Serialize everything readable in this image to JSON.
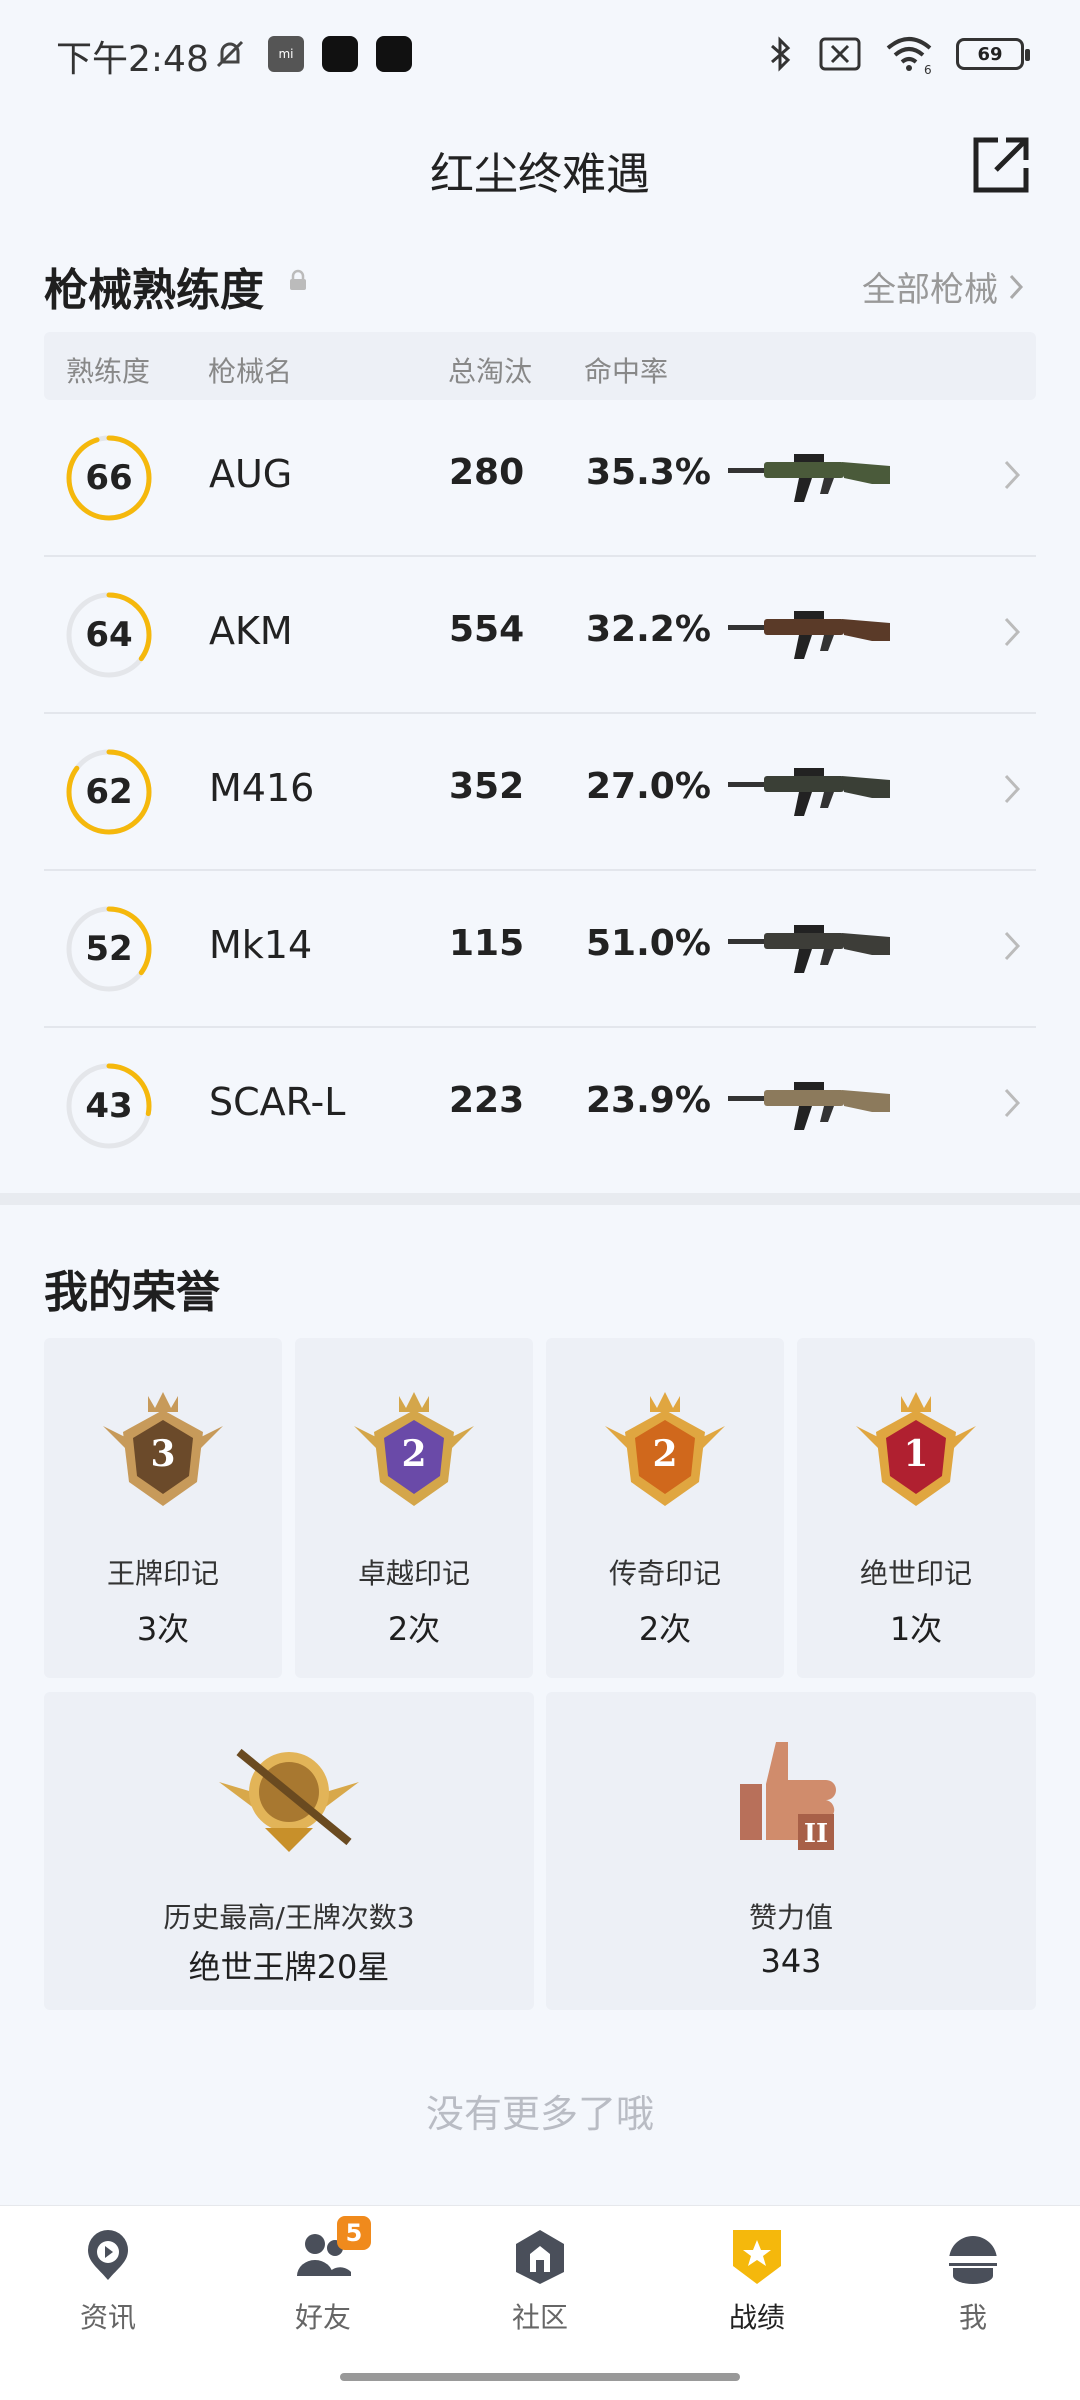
{
  "status_bar": {
    "time": "下午2:48",
    "mi_label": "mi",
    "battery": "69",
    "wifi_sub": "6"
  },
  "header": {
    "title": "红尘终难遇"
  },
  "mastery": {
    "title": "枪械熟练度",
    "all_link": "全部枪械",
    "columns": [
      "熟练度",
      "枪械名",
      "总淘汰",
      "命中率"
    ],
    "rows": [
      {
        "mastery": "66",
        "progress": 0.95,
        "name": "AUG",
        "kills": "280",
        "rate": "35.3%",
        "color": "#4a5a3a"
      },
      {
        "mastery": "64",
        "progress": 0.35,
        "name": "AKM",
        "kills": "554",
        "rate": "32.2%",
        "color": "#5a3a28"
      },
      {
        "mastery": "62",
        "progress": 0.85,
        "name": "M416",
        "kills": "352",
        "rate": "27.0%",
        "color": "#3a3f36"
      },
      {
        "mastery": "52",
        "progress": 0.35,
        "name": "Mk14",
        "kills": "115",
        "rate": "51.0%",
        "color": "#3d3d38"
      },
      {
        "mastery": "43",
        "progress": 0.28,
        "name": "SCAR-L",
        "kills": "223",
        "rate": "23.9%",
        "color": "#8c7a5c"
      }
    ]
  },
  "honor": {
    "title": "我的荣誉",
    "cards": [
      {
        "label": "王牌印记",
        "value": "3次",
        "badge_num": "3"
      },
      {
        "label": "卓越印记",
        "value": "2次",
        "badge_num": "2"
      },
      {
        "label": "传奇印记",
        "value": "2次",
        "badge_num": "2"
      },
      {
        "label": "绝世印记",
        "value": "1次",
        "badge_num": "1"
      }
    ],
    "wide_cards": [
      {
        "label": "历史最高/王牌次数3",
        "value": "绝世王牌20星"
      },
      {
        "label": "赞力值",
        "value": "343"
      }
    ]
  },
  "footer_text": "没有更多了哦",
  "nav": {
    "items": [
      {
        "label": "资讯",
        "icon": "news-icon"
      },
      {
        "label": "好友",
        "icon": "friends-icon",
        "badge": "5"
      },
      {
        "label": "社区",
        "icon": "community-icon"
      },
      {
        "label": "战绩",
        "icon": "record-icon",
        "active": true
      },
      {
        "label": "我",
        "icon": "profile-icon"
      }
    ]
  },
  "colors": {
    "accent": "#f5b80c",
    "ring_track": "#e4e6ea"
  }
}
